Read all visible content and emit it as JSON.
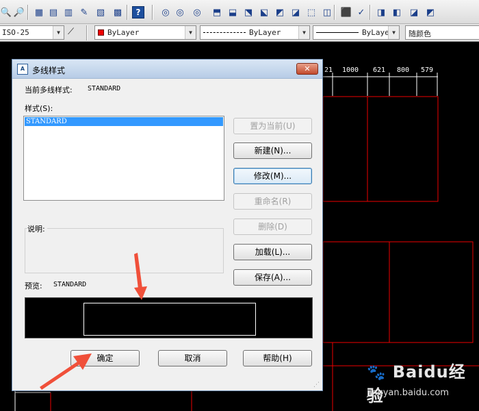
{
  "toolbar": {
    "icons": [
      "zoom-icon",
      "zoom-realtime-icon",
      "properties-icon",
      "design-center-icon",
      "tool-palettes-icon",
      "markup-icon",
      "sheet-set-icon",
      "calculator-icon",
      "help-icon",
      "union-icon",
      "subtract-icon",
      "intersect-icon",
      "extrude-icon",
      "revolve-icon",
      "box-icon",
      "slice-icon",
      "section-icon",
      "interference-icon",
      "shell-icon",
      "separate-icon",
      "clean-icon",
      "check-icon",
      "imprint-icon",
      "copy-edges-icon",
      "color-edges-icon",
      "copy-faces-icon"
    ],
    "icon_glyphs": [
      "🔍",
      "🔎",
      "▦",
      "▤",
      "▥",
      "✎",
      "▧",
      "▩",
      "?",
      "◎",
      "◎",
      "◎",
      "⬒",
      "⬓",
      "⬔",
      "⬕",
      "◩",
      "◪",
      "⬚",
      "◫",
      "⬛",
      "✓",
      "◨",
      "◧",
      "◪",
      "◩"
    ]
  },
  "props_bar": {
    "dimstyle": "ISO-25",
    "layer_color_label": "ByLayer",
    "linetype_label": "ByLayer",
    "lineweight_label": "ByLayer",
    "plot_color_label": "随颜色"
  },
  "drawing": {
    "dimensions": [
      "21",
      "1000",
      "621",
      "800",
      "579"
    ],
    "colors": {
      "background": "#000000",
      "lines": "#ff0000",
      "dim_lines": "#ffffff"
    }
  },
  "dialog": {
    "title": "多线样式",
    "close_glyph": "✕",
    "current_style_label": "当前多线样式:",
    "current_style_value": "STANDARD",
    "styles_label": "样式(S):",
    "styles": [
      "STANDARD"
    ],
    "description_label": "说明:",
    "preview_label": "预览:",
    "preview_value": "STANDARD",
    "buttons": {
      "set_current": "置为当前(U)",
      "new": "新建(N)...",
      "modify": "修改(M)...",
      "rename": "重命名(R)",
      "delete": "删除(D)",
      "load": "加载(L)...",
      "save": "保存(A)...",
      "ok": "确定",
      "cancel": "取消",
      "help": "帮助(H)"
    }
  },
  "watermark": {
    "brand": "Baidu经验",
    "url": "jingyan.baidu.com"
  }
}
